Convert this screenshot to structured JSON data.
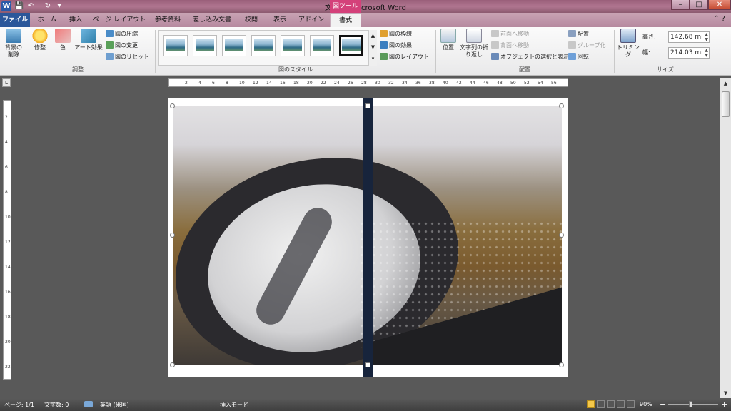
{
  "window": {
    "title": "文書 1 - Microsoft Word",
    "app_icon_letter": "W",
    "contextual_group": "図ツール",
    "minimize": "–",
    "maximize": "□",
    "close": "✕"
  },
  "quick_access": {
    "save": "💾",
    "undo": "↶",
    "redo": "↻",
    "customize": "▾"
  },
  "tabs": [
    {
      "label": "ファイル"
    },
    {
      "label": "ホーム"
    },
    {
      "label": "挿入"
    },
    {
      "label": "ページ レイアウト"
    },
    {
      "label": "参考資料"
    },
    {
      "label": "差し込み文書"
    },
    {
      "label": "校閲"
    },
    {
      "label": "表示"
    },
    {
      "label": "アドイン"
    },
    {
      "label": "書式"
    }
  ],
  "help_icons": "⌃ ?",
  "ribbon": {
    "adjust": {
      "label": "調整",
      "remove_bg": "背景の削除",
      "corrections": "修整",
      "color": "色",
      "artistic": "アート効果",
      "compress": "図の圧縮",
      "change": "図の変更",
      "reset": "図のリセット"
    },
    "styles": {
      "label": "図のスタイル",
      "border": "図の枠線",
      "effects": "図の効果",
      "layout": "図のレイアウト"
    },
    "arrange": {
      "label": "配置",
      "position": "位置",
      "wrap": "文字列の折り返し",
      "forward": "前面へ移動",
      "backward": "背面へ移動",
      "selection": "オブジェクトの選択と表示",
      "align": "配置",
      "group": "グループ化",
      "rotate": "回転"
    },
    "size": {
      "label": "サイズ",
      "crop": "トリミング",
      "height_label": "高さ:",
      "height_value": "142.68 mi",
      "width_label": "幅:",
      "width_value": "214.03 mi"
    }
  },
  "ruler": {
    "h_ticks": [
      "2",
      "4",
      "6",
      "8",
      "10",
      "12",
      "14",
      "16",
      "18",
      "20",
      "22",
      "24",
      "26",
      "28",
      "30",
      "32",
      "34",
      "36",
      "38",
      "40",
      "42",
      "44",
      "46",
      "48",
      "50",
      "52",
      "54",
      "56"
    ],
    "v_ticks": [
      "2",
      "4",
      "6",
      "8",
      "10",
      "12",
      "14",
      "16",
      "18",
      "20",
      "22"
    ]
  },
  "statusbar": {
    "page": "ページ: 1/1",
    "words": "文字数: 0",
    "language": "英語 (米国)",
    "mode": "挿入モード",
    "zoom": "90%",
    "zoom_out": "−",
    "zoom_in": "+"
  }
}
